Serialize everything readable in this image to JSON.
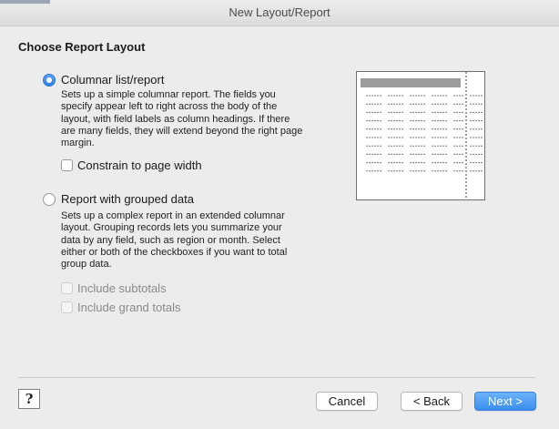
{
  "window": {
    "title": "New Layout/Report"
  },
  "heading": "Choose Report Layout",
  "option_columnar": {
    "label": "Columnar list/report",
    "selected": true,
    "description_lines": [
      "Sets up a simple columnar report. The fields you",
      "specify appear left to right across the body of the",
      "layout, with field labels as column headings. If there",
      "are many fields, they will extend beyond the right page",
      "margin."
    ],
    "constrain_label": "Constrain to page width",
    "constrain_checked": false
  },
  "option_grouped": {
    "label": "Report with grouped data",
    "selected": false,
    "description_lines": [
      "Sets up a complex report in an extended columnar",
      "layout. Grouping records lets you summarize your",
      "data by any field, such as region or month. Select",
      "either or both of the checkboxes if you want to total",
      "group data."
    ],
    "subtotals_label": "Include subtotals",
    "grand_totals_label": "Include grand totals"
  },
  "buttons": {
    "help": "?",
    "cancel": "Cancel",
    "back": "< Back",
    "next": "Next >"
  },
  "colors": {
    "accent": "#3b8ef0",
    "background": "#ececec"
  }
}
